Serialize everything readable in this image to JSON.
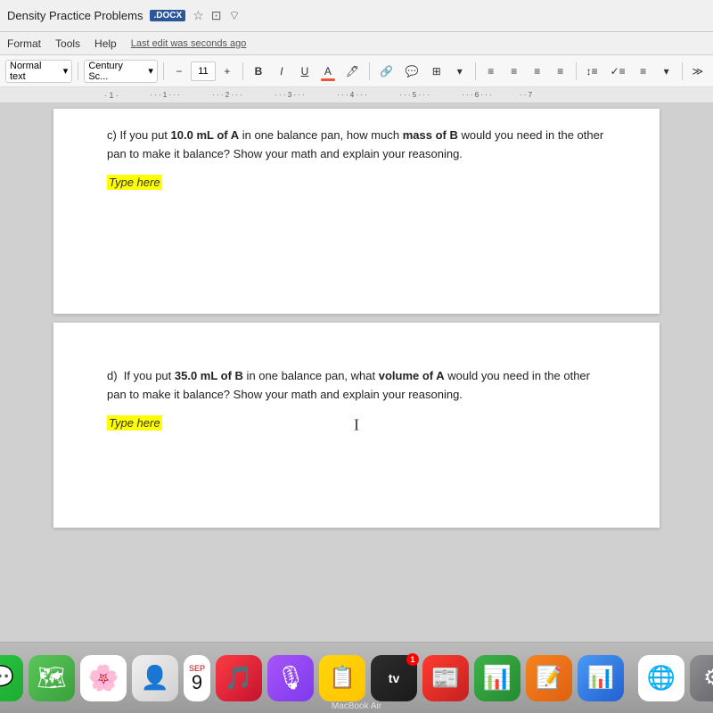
{
  "titleBar": {
    "title": "Density Practice Problems",
    "badge": ".DOCX",
    "icons": [
      "★",
      "⊞",
      "☁"
    ]
  },
  "menuBar": {
    "items": [
      "Format",
      "Tools",
      "Help"
    ],
    "lastEdit": "Last edit was seconds ago"
  },
  "toolbar": {
    "styleSelect": "Normal text",
    "fontSelect": "Century Sc...",
    "fontSize": "11",
    "minus": "−",
    "plus": "+",
    "bold": "B",
    "italic": "I",
    "underline": "U",
    "fontColor": "A",
    "highlight": "🖊",
    "link": "🔗",
    "comment": "💬",
    "image": "⊞",
    "alignLeft": "≡",
    "alignCenter": "≡",
    "alignRight": "≡",
    "alignJustify": "≡",
    "lineSpacing": "↕",
    "checklist": "✓≡",
    "bulletList": "≡",
    "more": "≫"
  },
  "ruler": {
    "marks": [
      "1",
      "2",
      "3",
      "4",
      "5",
      "6",
      "7"
    ]
  },
  "page1": {
    "question": "c) If you put 10.0 mL of A in one balance pan, how much mass of B would you need in the other pan to make it balance?  Show your math and explain your reasoning.",
    "bold1": "10.0 mL",
    "bold2": "mass of B",
    "answer": "Type here"
  },
  "page2": {
    "label": "d)",
    "question": "If you put 35.0 mL of B in one balance pan, what volume of A would you need in the other pan to make it balance?  Show your math and explain your reasoning.",
    "bold1": "35.0 mL",
    "bold2": "volume of A",
    "answer": "Type here"
  },
  "dock": {
    "date_month": "SEP",
    "date_day": "9",
    "macbook_label": "MacBook Air",
    "badge_appletv": "1"
  }
}
